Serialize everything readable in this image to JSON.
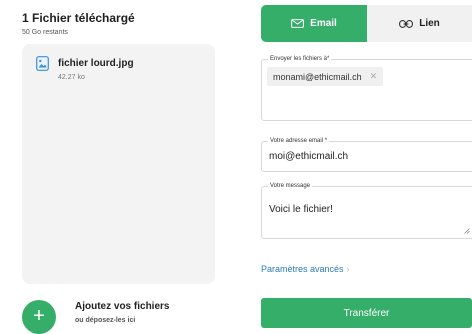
{
  "upload": {
    "title": "1 Fichier téléchargé",
    "remaining": "50 Go restants"
  },
  "files": [
    {
      "name": "fichier lourd.jpg",
      "size": "42.27 ko",
      "icon": "image-file-icon"
    }
  ],
  "add_files": {
    "title": "Ajoutez vos fichiers",
    "subtitle": "ou déposez-les ici",
    "icon": "plus-icon"
  },
  "tabs": {
    "email_label": "Email",
    "lien_label": "Lien",
    "email_icon": "envelope-icon",
    "lien_icon": "link-icon",
    "active": "Email"
  },
  "form": {
    "recipients_label": "Envoyer les fichiers à*",
    "recipients": [
      "monami@ethicmail.ch"
    ],
    "sender_label": "Votre adresse email *",
    "sender_value": "moi@ethicmail.ch",
    "message_label": "Votre message",
    "message_value": "Voici le fichier!"
  },
  "advanced_label": "Paramètres avancés",
  "transfer_label": "Transférer",
  "colors": {
    "accent": "#35ae6a",
    "link": "#2a7bbf",
    "panel": "#f3f3f3"
  }
}
